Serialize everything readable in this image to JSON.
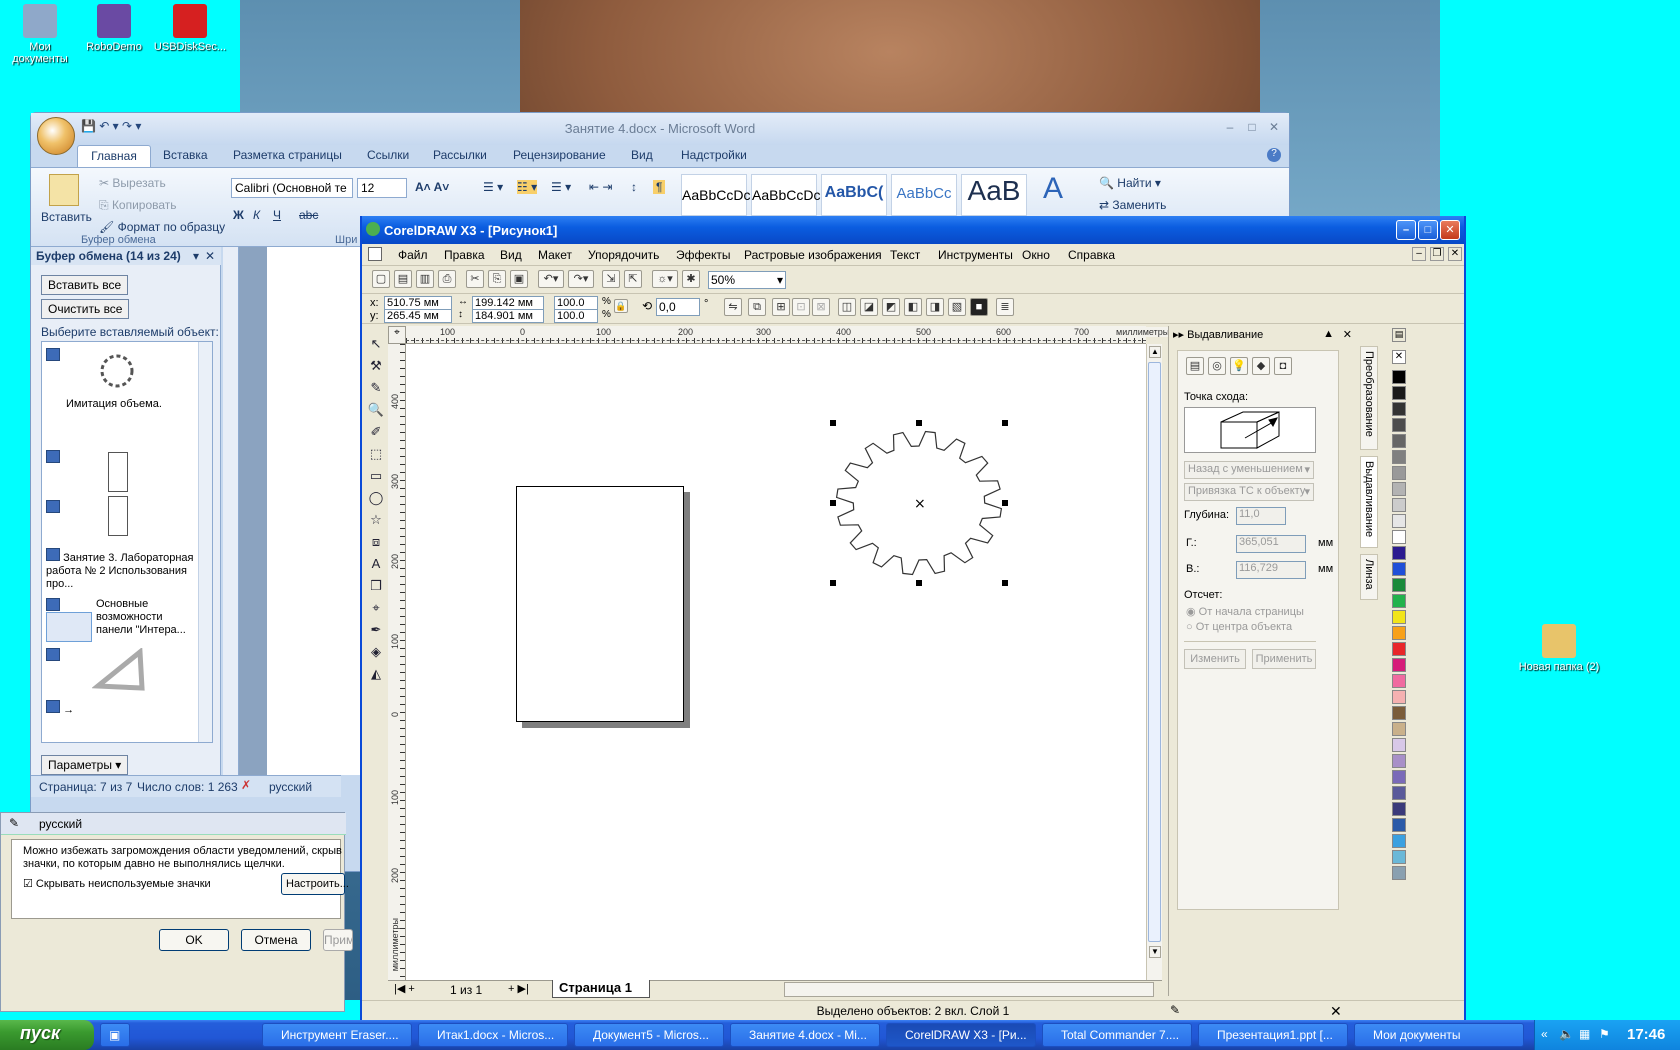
{
  "desktop": {
    "icons": [
      {
        "label": "Мои документы",
        "color": "#8fa8c9"
      },
      {
        "label": "RoboDemo",
        "color": "#6a4aa3"
      },
      {
        "label": "USBDiskSec...",
        "color": "#d62020"
      },
      {
        "label": "Новая папка (2)",
        "color": "#e8c46a"
      }
    ]
  },
  "word": {
    "title": "Занятие 4.docx - Microsoft Word",
    "tabs": [
      "Главная",
      "Вставка",
      "Разметка страницы",
      "Ссылки",
      "Рассылки",
      "Рецензирование",
      "Вид",
      "Надстройки"
    ],
    "clipboard_group": {
      "paste": "Вставить",
      "cut": "Вырезать",
      "copy": "Копировать",
      "format_painter": "Формат по образцу",
      "group_label": "Буфер обмена"
    },
    "font": {
      "name": "Calibri (Основной те",
      "size": "12",
      "group_label": "Шри"
    },
    "styles": [
      "AaBbCcDc",
      "AaBbCcDc",
      "AaBbC(",
      "AaBbCc",
      "AaB"
    ],
    "editing": {
      "find": "Найти",
      "replace": "Заменить"
    },
    "clip_pane": {
      "title": "Буфер обмена (14 из 24)",
      "paste_all": "Вставить все",
      "clear_all": "Очистить все",
      "hint": "Выберите вставляемый объект:",
      "items": [
        "",
        "Имитация объема.",
        "",
        "",
        "Занятие 3. Лабораторная работа № 2 Использования про...",
        "Основные возможности панели \"Интера...",
        "",
        "→"
      ],
      "options": "Параметры"
    },
    "status": {
      "page": "Страница: 7 из 7",
      "words": "Число слов: 1 263",
      "lang": "русский"
    }
  },
  "dialog": {
    "lang": "русский",
    "text": "Можно избежать загромождения области уведомлений, скрыв значки, по которым давно не выполнялись щелчки.",
    "checkbox": "Скрывать неиспользуемые значки",
    "customize": "Настроить...",
    "ok": "OK",
    "cancel": "Отмена",
    "apply": "Прим"
  },
  "corel": {
    "title": "CorelDRAW X3 - [Рисунок1]",
    "menu": [
      "Файл",
      "Правка",
      "Вид",
      "Макет",
      "Упорядочить",
      "Эффекты",
      "Растровые изображения",
      "Текст",
      "Инструменты",
      "Окно",
      "Справка"
    ],
    "zoom": "50%",
    "props": {
      "x": "510.75 мм",
      "y": "265.45 мм",
      "w": "199.142 мм",
      "h": "184.901 мм",
      "sx": "100.0",
      "sy": "100.0",
      "angle": "0,0"
    },
    "ruler_units": "миллиметры",
    "ruler_h": [
      "100",
      "0",
      "100",
      "200",
      "300",
      "400",
      "500",
      "600",
      "700"
    ],
    "ruler_v": [
      "400",
      "300",
      "200",
      "100",
      "0",
      "100",
      "200"
    ],
    "page_nav": "1 из 1",
    "page_tab": "Страница 1",
    "status": "Выделено объектов: 2 вкл. Слой 1",
    "docker": {
      "title": "Выдавливание",
      "vanishing_label": "Точка схода:",
      "mode": "Назад с уменьшением",
      "snap": "Привязка ТС к объекту",
      "depth_label": "Глубина:",
      "depth": "11,0",
      "h_label": "Г.:",
      "h": "365,051",
      "v_label": "В.:",
      "v": "116,729",
      "unit": "мм",
      "origin_label": "Отсчет:",
      "from_page": "От начала страницы",
      "from_center": "От центра объекта",
      "edit": "Изменить",
      "apply": "Применить",
      "tabs": [
        "Преобразование",
        "Выдавливание",
        "Линза"
      ]
    },
    "palette": [
      "#000000",
      "#1a1a1a",
      "#333333",
      "#4d4d4d",
      "#666666",
      "#808080",
      "#999999",
      "#b3b3b3",
      "#cccccc",
      "#e6e6e6",
      "#ffffff",
      "#2b1b8f",
      "#1f4fd8",
      "#1a8a3a",
      "#22b24c",
      "#f2e51a",
      "#f7a11a",
      "#e8262a",
      "#d61c7a",
      "#f06aa0",
      "#f5b1b1",
      "#7a5c3a",
      "#c9b08a",
      "#d8c8e8",
      "#a890c8",
      "#7a6ab8",
      "#5a5a9a",
      "#3a3a7a",
      "#2a5aa8",
      "#3aa0e0",
      "#6ab8d8",
      "#8aa0b0"
    ]
  },
  "taskbar": {
    "start": "пуск",
    "tasks": [
      "Инструмент Eraser....",
      "Итак1.docx - Micros...",
      "Документ5 - Micros...",
      "Занятие 4.docx - Mi...",
      "CorelDRAW X3 - [Ри...",
      "Total Commander 7....",
      "Презентация1.ppt [...",
      "Мои документы"
    ],
    "time": "17:46"
  }
}
